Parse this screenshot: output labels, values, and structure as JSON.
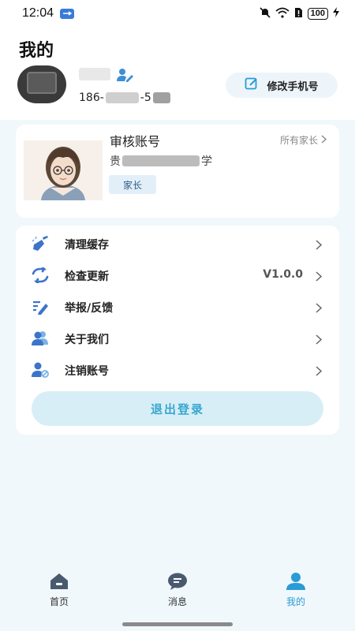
{
  "status_bar": {
    "time": "12:04",
    "battery": "100"
  },
  "header": {
    "title": "我的",
    "phone_prefix": "186-",
    "phone_mid": "-5",
    "change_phone_label": "修改手机号"
  },
  "account_card": {
    "title": "审核账号",
    "all_parents_label": "所有家长",
    "school_prefix": "贵",
    "school_suffix": "学",
    "role": "家长"
  },
  "menu": {
    "items": [
      {
        "label": "清理缓存",
        "icon": "broom-icon",
        "value": ""
      },
      {
        "label": "检查更新",
        "icon": "refresh-icon",
        "value": "V1.0.0"
      },
      {
        "label": "举报/反馈",
        "icon": "feedback-icon",
        "value": ""
      },
      {
        "label": "关于我们",
        "icon": "people-icon",
        "value": ""
      },
      {
        "label": "注销账号",
        "icon": "user-cancel-icon",
        "value": ""
      }
    ],
    "logout_label": "退出登录"
  },
  "bottom_nav": {
    "items": [
      {
        "label": "首页",
        "icon": "home-icon",
        "active": false
      },
      {
        "label": "消息",
        "icon": "message-icon",
        "active": false
      },
      {
        "label": "我的",
        "icon": "profile-icon",
        "active": true
      }
    ]
  },
  "colors": {
    "accent": "#2a9bd6",
    "icon_blue": "#3d74c9",
    "logout_text": "#37a7cf",
    "page_bg": "#f1f8fc"
  }
}
